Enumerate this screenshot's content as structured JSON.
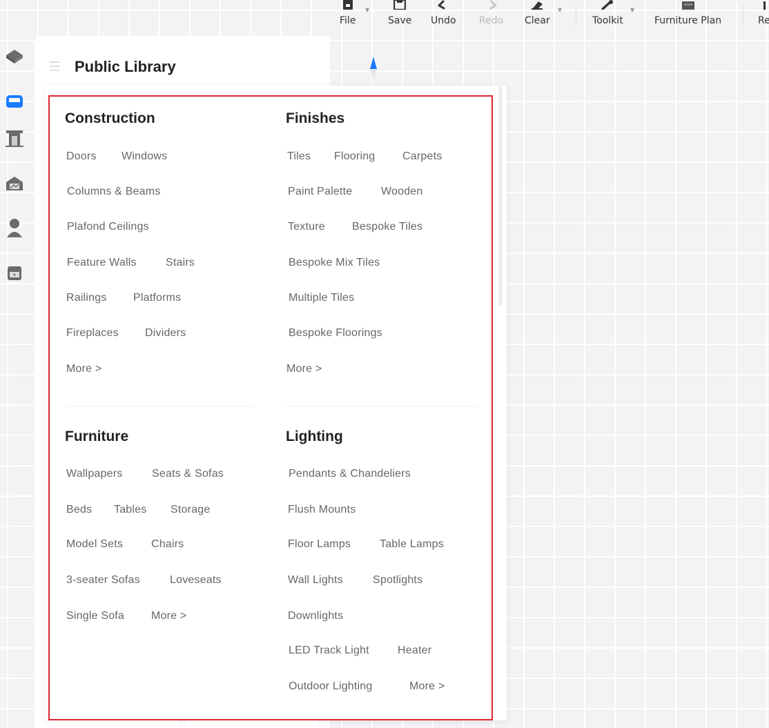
{
  "toolbar": {
    "file": "File",
    "save": "Save",
    "undo": "Undo",
    "redo": "Redo",
    "clear": "Clear",
    "toolkit": "Toolkit",
    "furniture_plan": "Furniture Plan",
    "cut_label": "Re"
  },
  "library": {
    "title": "Public Library"
  },
  "categories": {
    "construction": {
      "title": "Construction",
      "links": [
        "Doors",
        "Windows",
        "Columns & Beams",
        "Plafond Ceilings",
        "Feature Walls",
        "Stairs",
        "Railings",
        "Platforms",
        "Fireplaces",
        "Dividers"
      ],
      "more": "More >"
    },
    "finishes": {
      "title": "Finishes",
      "links": [
        "Tiles",
        "Flooring",
        "Carpets",
        "Paint Palette",
        "Wooden",
        "Texture",
        "Bespoke Tiles",
        "Bespoke Mix Tiles",
        "Multiple Tiles",
        "Bespoke Floorings"
      ],
      "more": "More >"
    },
    "furniture": {
      "title": "Furniture",
      "links": [
        "Wallpapers",
        "Seats & Sofas",
        "Beds",
        "Tables",
        "Storage",
        "Model Sets",
        "Chairs",
        "3-seater Sofas",
        "Loveseats",
        "Single Sofa"
      ],
      "more": "More >"
    },
    "lighting": {
      "title": "Lighting",
      "links": [
        "Pendants & Chandeliers",
        "Flush Mounts",
        "Floor Lamps",
        "Table Lamps",
        "Wall Lights",
        "Spotlights",
        "Downlights",
        "LED Track Light",
        "Heater",
        "Outdoor Lighting"
      ],
      "more": "More >"
    }
  },
  "colors": {
    "accent_blue": "#1a7cff",
    "highlight_red": "#e0262f",
    "rail_icon": "#6b6b6b"
  }
}
